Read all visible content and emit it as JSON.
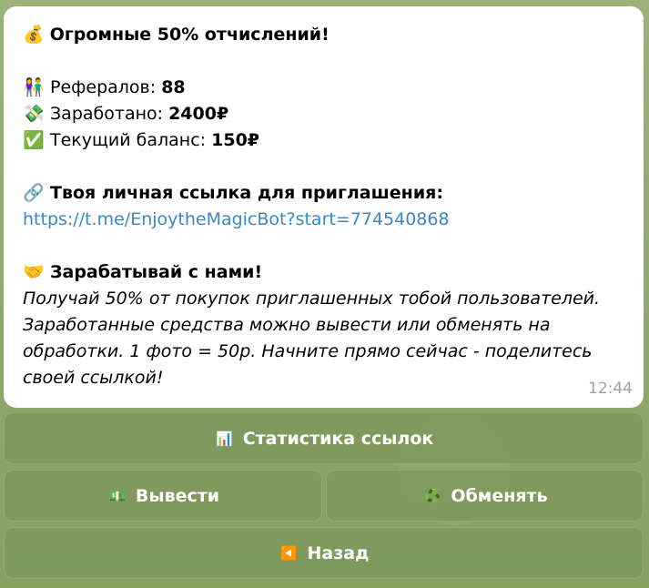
{
  "message": {
    "title_emoji": "💰",
    "title": "Огромные 50% отчислений!",
    "referrals_emoji": "👫",
    "referrals_label": "Рефералов:",
    "referrals_value": "88",
    "earned_emoji": "💸",
    "earned_label": "Заработано:",
    "earned_value": "2400₽",
    "balance_emoji": "✅",
    "balance_label": "Текущий баланс:",
    "balance_value": "150₽",
    "link_emoji": "🔗",
    "link_heading": "Твоя личная ссылка для приглашения:",
    "link_url": "https://t.me/EnjoytheMagicBot?start=774540868",
    "earn_emoji": "🤝",
    "earn_heading": "Зарабатывай с нами!",
    "description_lines": [
      "Получай 50% от покупок приглашенных тобой пользователей.",
      "Заработанные средства можно вывести или обменять на",
      "обработки. 1 фото = 50р. Начните прямо сейчас - поделитесь",
      "своей ссылкой!"
    ],
    "time": "12:44"
  },
  "keyboard": {
    "stats": {
      "icon": "📊",
      "label": "Статистика ссылок"
    },
    "withdraw": {
      "icon": "💵",
      "label": "Вывести"
    },
    "exchange": {
      "icon": "♻️",
      "label": "Обменять"
    },
    "back": {
      "icon": "◀️",
      "label": "Назад"
    }
  }
}
